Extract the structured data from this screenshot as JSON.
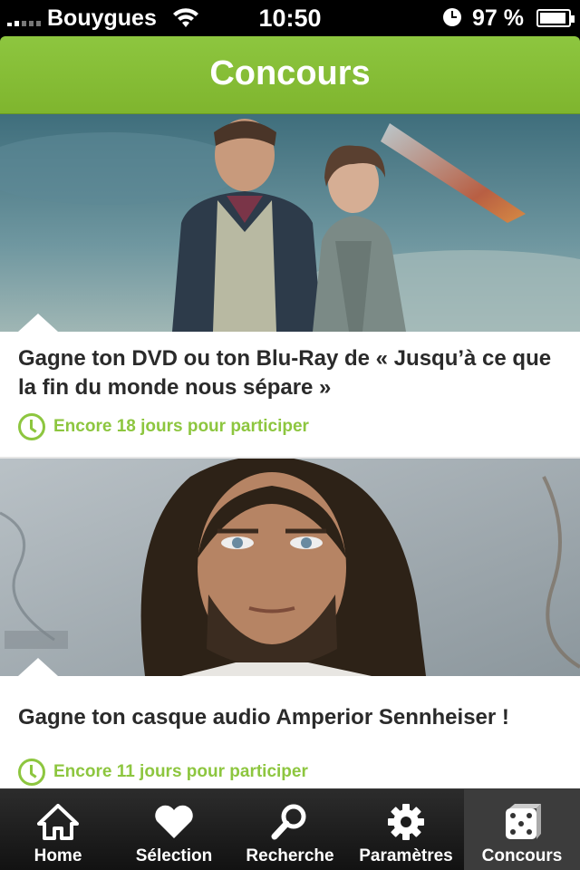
{
  "status_bar": {
    "carrier": "Bouygues",
    "time": "10:50",
    "battery": "97 %"
  },
  "header": {
    "title": "Concours"
  },
  "contests": [
    {
      "title": "Gagne ton DVD ou ton Blu-Ray de « Jusqu’à ce que la fin du monde nous sépare »",
      "deadline": "Encore 18 jours pour participer",
      "icon": "clock-icon"
    },
    {
      "title": "Gagne ton casque audio Amperior Sennheiser !",
      "deadline": "Encore 11 jours pour participer",
      "icon": "clock-icon"
    }
  ],
  "tabs": [
    {
      "label": "Home",
      "icon": "home-icon"
    },
    {
      "label": "Sélection",
      "icon": "heart-icon"
    },
    {
      "label": "Recherche",
      "icon": "search-icon"
    },
    {
      "label": "Paramètres",
      "icon": "gear-icon"
    },
    {
      "label": "Concours",
      "icon": "dice-icon",
      "active": true
    }
  ],
  "colors": {
    "accent": "#8dc63f",
    "tabbar": "#1c1c1c"
  }
}
